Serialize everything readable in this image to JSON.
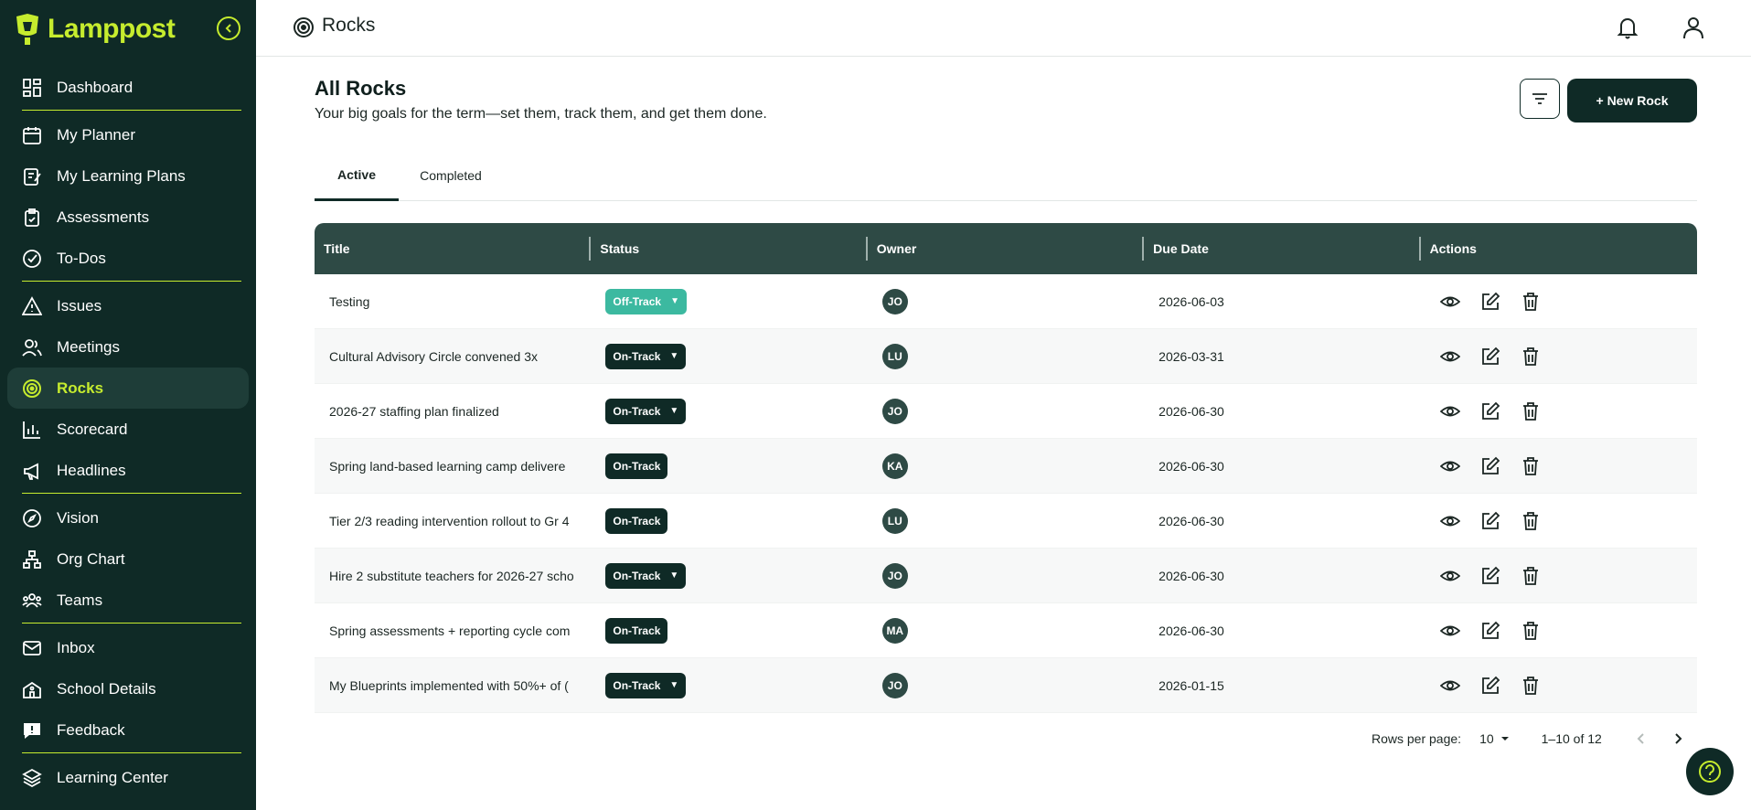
{
  "brand": {
    "name": "Lamppost",
    "accent": "#c6ec2e",
    "sidebar_bg": "#0f2a26"
  },
  "sidebar": {
    "items": [
      {
        "label": "Dashboard",
        "icon": "dashboard-icon"
      },
      {
        "label": "My Planner",
        "icon": "calendar-icon"
      },
      {
        "label": "My Learning Plans",
        "icon": "edit-note-icon"
      },
      {
        "label": "Assessments",
        "icon": "clipboard-icon"
      },
      {
        "label": "To-Dos",
        "icon": "check-circle-icon"
      },
      {
        "label": "Issues",
        "icon": "warning-icon"
      },
      {
        "label": "Meetings",
        "icon": "people-icon"
      },
      {
        "label": "Rocks",
        "icon": "target-icon",
        "active": true
      },
      {
        "label": "Scorecard",
        "icon": "bar-chart-icon"
      },
      {
        "label": "Headlines",
        "icon": "megaphone-icon"
      },
      {
        "label": "Vision",
        "icon": "compass-icon"
      },
      {
        "label": "Org Chart",
        "icon": "org-chart-icon"
      },
      {
        "label": "Teams",
        "icon": "team-icon"
      },
      {
        "label": "Inbox",
        "icon": "mail-icon"
      },
      {
        "label": "School Details",
        "icon": "school-icon"
      },
      {
        "label": "Feedback",
        "icon": "feedback-icon"
      },
      {
        "label": "Learning Center",
        "icon": "layers-icon"
      }
    ]
  },
  "header": {
    "title": "Rocks"
  },
  "main": {
    "heading": "All Rocks",
    "subheading": "Your big goals for the term—set them, track them, and get them done.",
    "new_button": "+ New Rock",
    "tabs": [
      {
        "label": "Active"
      },
      {
        "label": "Completed"
      }
    ],
    "columns": [
      "Title",
      "Status",
      "Owner",
      "Due Date",
      "Actions"
    ],
    "rows": [
      {
        "title": "Testing",
        "status": "Off-Track",
        "owner": "JO",
        "due": "2026-06-03"
      },
      {
        "title": "Cultural Advisory Circle convened 3x",
        "status": "On-Track",
        "owner": "LU",
        "due": "2026-03-31"
      },
      {
        "title": "2026-27 staffing plan finalized",
        "status": "On-Track",
        "owner": "JO",
        "due": "2026-06-30"
      },
      {
        "title": "Spring land-based learning camp delivere",
        "status": "On-Track",
        "owner": "KA",
        "due": "2026-06-30"
      },
      {
        "title": "Tier 2/3 reading intervention rollout to Gr 4",
        "status": "On-Track",
        "owner": "LU",
        "due": "2026-06-30"
      },
      {
        "title": "Hire 2 substitute teachers for 2026-27 scho",
        "status": "On-Track",
        "owner": "JO",
        "due": "2026-06-30"
      },
      {
        "title": "Spring assessments + reporting cycle com",
        "status": "On-Track",
        "owner": "MA",
        "due": "2026-06-30"
      },
      {
        "title": "My Blueprints implemented with 50%+ of (",
        "status": "On-Track",
        "owner": "JO",
        "due": "2026-01-15"
      }
    ]
  },
  "pagination": {
    "rows_label": "Rows per page:",
    "rows_value": "10",
    "range": "1–10 of 12"
  }
}
